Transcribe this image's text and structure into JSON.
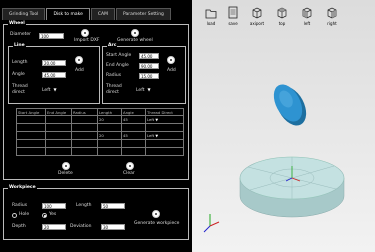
{
  "tabs": [
    "Grinding Tool",
    "Disk to make",
    "CAM",
    "Parameter Setting"
  ],
  "active_tab": 1,
  "wheel": {
    "legend": "Wheel",
    "diameter_label": "Diameter",
    "diameter_value": "100",
    "import_label": "Import DXF",
    "generate_label": "Generate wheel"
  },
  "line": {
    "legend": "Line",
    "length_label": "Length",
    "length_value": "20.00",
    "angle_label": "Angle",
    "angle_value": "45.00",
    "thread_label": "Thread",
    "direct_label": "direct",
    "direct_value": "Left",
    "add_label": "Add"
  },
  "arc": {
    "legend": "Arc",
    "start_label": "Start Angle",
    "start_value": "45.00",
    "end_label": "End Angle",
    "end_value": "90.00",
    "radius_label": "Radius",
    "radius_value": "15.00",
    "thread_label": "Thread",
    "direct_label": "direct",
    "direct_value": "Left",
    "add_label": "Add"
  },
  "table": {
    "headers": [
      "Start Angle",
      "End Angle",
      "Radius",
      "Length",
      "Angle",
      "Thread Direct"
    ],
    "rows": [
      [
        "",
        "",
        "",
        "20",
        "45",
        "Left"
      ],
      [
        "",
        "",
        "",
        "",
        "",
        ""
      ],
      [
        "",
        "",
        "",
        "20",
        "45",
        "Left"
      ],
      [
        "",
        "",
        "",
        "",
        "",
        ""
      ],
      [
        "",
        "",
        "",
        "",
        "",
        ""
      ]
    ]
  },
  "delete_label": "Delete",
  "clear_label": "Clear",
  "workpiece": {
    "legend": "Workpiece",
    "radius_label": "Radius",
    "radius_value": "100",
    "length_label": "Length",
    "length_value": "50",
    "hole_label": "Hole",
    "yes_label": "Yes",
    "depth_label": "Depth",
    "depth_value": "20",
    "deviation_label": "Deviation",
    "deviation_value": "30",
    "generate_label": "Generate workpiece"
  },
  "toolbar": [
    {
      "label": "load",
      "icon": "folder-icon"
    },
    {
      "label": "save",
      "icon": "document-icon"
    },
    {
      "label": "axiport",
      "icon": "cube-iso-icon"
    },
    {
      "label": "top",
      "icon": "cube-top-icon"
    },
    {
      "label": "left",
      "icon": "cube-left-icon"
    },
    {
      "label": "right",
      "icon": "cube-right-icon"
    }
  ],
  "colors": {
    "panel_bg": "#000000",
    "viewport_bg": "#e6e6e6",
    "disk": "#2e93d1",
    "workpiece": "#b9d8d8"
  }
}
